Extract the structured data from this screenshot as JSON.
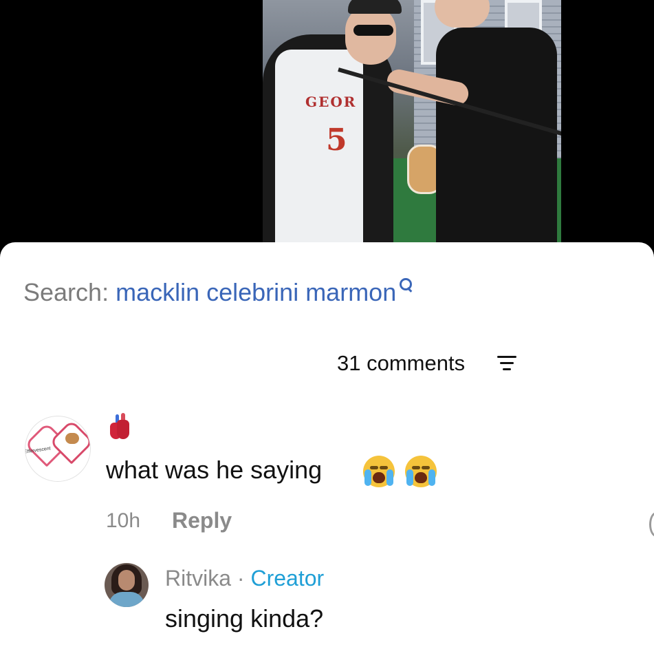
{
  "search": {
    "label": "Search:",
    "query": "macklin celebrini marmon"
  },
  "comments": {
    "count_label": "31 comments"
  },
  "comment": {
    "avatar_text": "Effervescent",
    "text": "what was he saying",
    "time": "10h",
    "reply_label": "Reply"
  },
  "reply_comment": {
    "author": "Ritvika",
    "separator": "·",
    "badge": "Creator",
    "text": "singing kinda?"
  },
  "video": {
    "jersey_name": "GEOR",
    "jersey_number": "5"
  },
  "colors": {
    "link": "#3a66b8",
    "creator": "#1f9fd6",
    "muted": "#8a8a8a"
  }
}
